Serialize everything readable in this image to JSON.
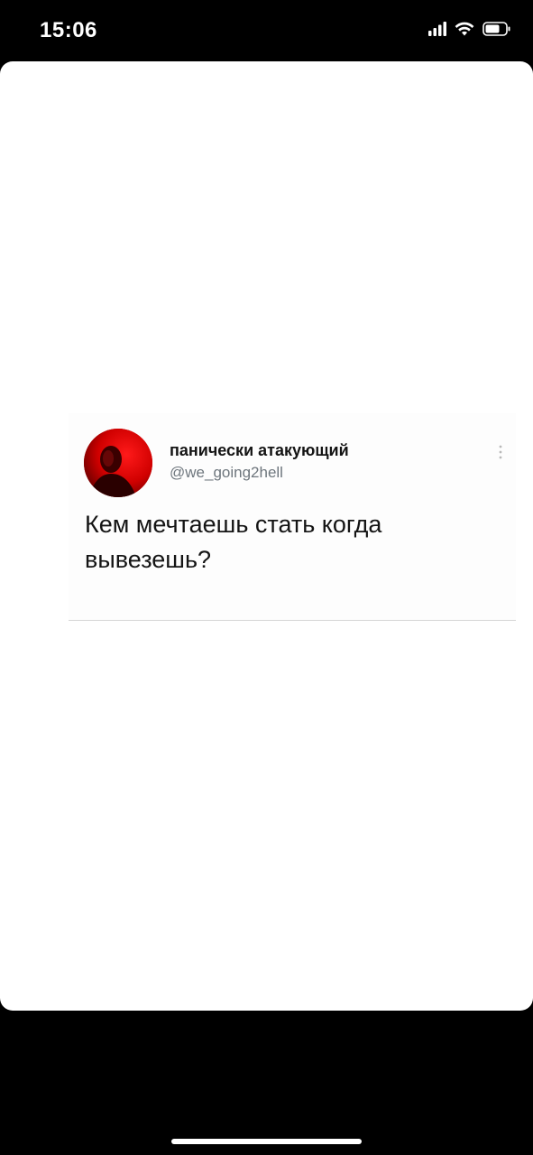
{
  "status_bar": {
    "time": "15:06",
    "icons": [
      "cellular-signal-icon",
      "wifi-icon",
      "battery-icon"
    ]
  },
  "tweet": {
    "display_name": "панически атакующий",
    "handle": "@we_going2hell",
    "text": "Кем мечтаешь стать когда вывезешь?",
    "avatar_icon": "profile-avatar",
    "menu_icon": "more-vertical-icon"
  },
  "colors": {
    "background": "#000000",
    "sheet": "#ffffff",
    "avatar_accent": "#d40000",
    "handle": "#6e767d",
    "text": "#141414"
  }
}
